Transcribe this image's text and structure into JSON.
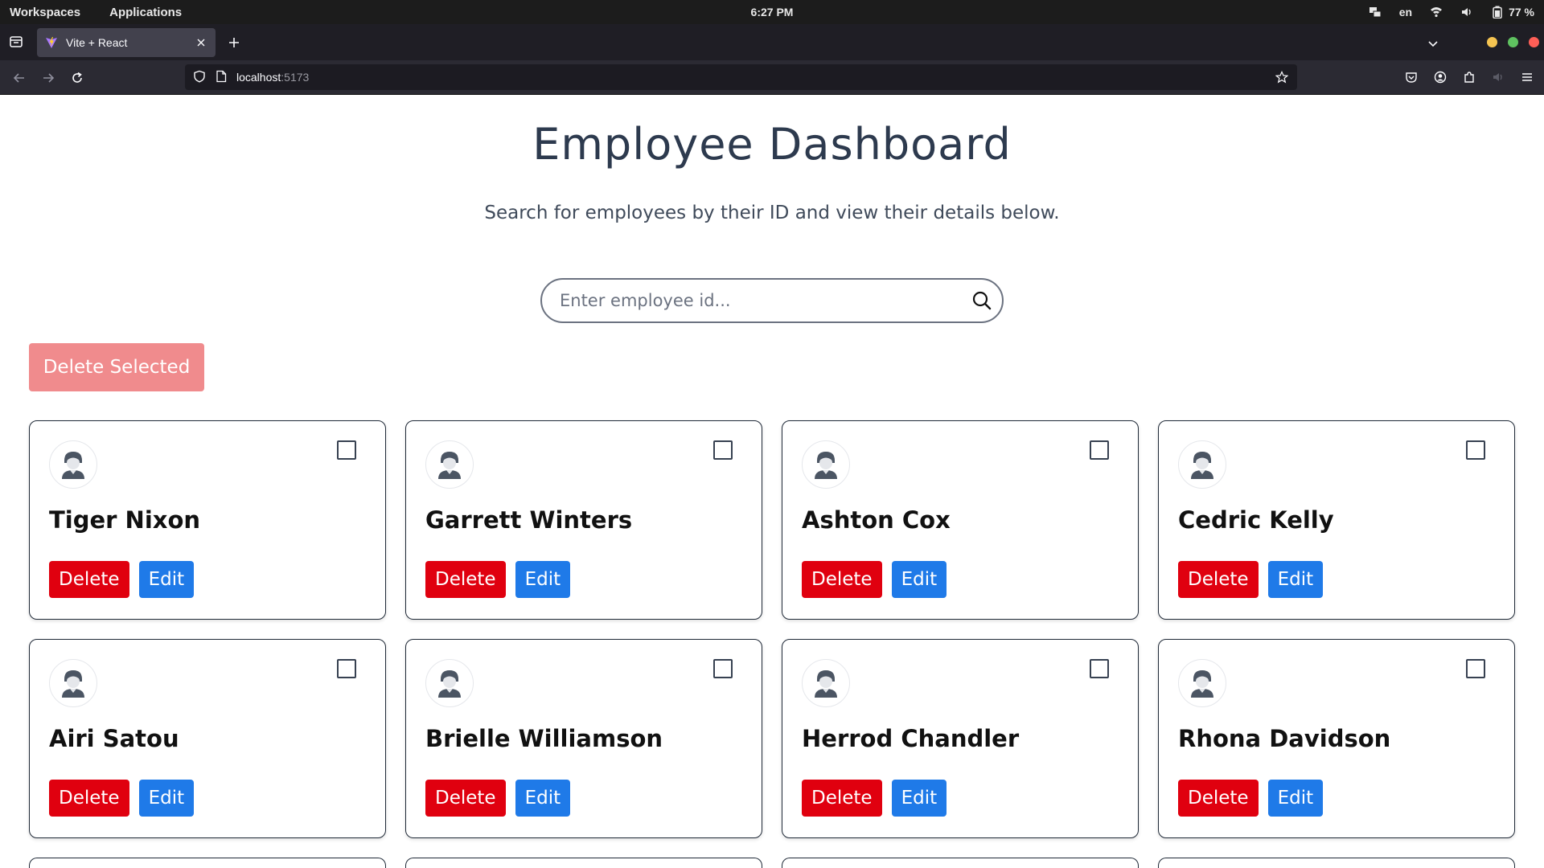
{
  "os": {
    "workspaces_label": "Workspaces",
    "applications_label": "Applications",
    "clock": "6:27 PM",
    "language": "en",
    "battery": "77 %",
    "icons": [
      "network-icon",
      "wifi-icon",
      "volume-icon",
      "battery-icon"
    ]
  },
  "browser": {
    "tab_title": "Vite + React",
    "url_host": "localhost",
    "url_port": ":5173",
    "colors": {
      "close": "#ff5f57",
      "minimize": "#f5c451",
      "maximize": "#5fc260"
    }
  },
  "page": {
    "title": "Employee Dashboard",
    "subtitle": "Search for employees by their ID and view their details below.",
    "search_placeholder": "Enter employee id...",
    "bulk_delete_label": "Delete Selected",
    "delete_label": "Delete",
    "edit_label": "Edit",
    "colors": {
      "delete": "#e0000f",
      "edit": "#1f7ae8",
      "bulk_delete": "#f08b8d"
    }
  },
  "employees": [
    {
      "name": "Tiger Nixon"
    },
    {
      "name": "Garrett Winters"
    },
    {
      "name": "Ashton Cox"
    },
    {
      "name": "Cedric Kelly"
    },
    {
      "name": "Airi Satou"
    },
    {
      "name": "Brielle Williamson"
    },
    {
      "name": "Herrod Chandler"
    },
    {
      "name": "Rhona Davidson"
    }
  ]
}
